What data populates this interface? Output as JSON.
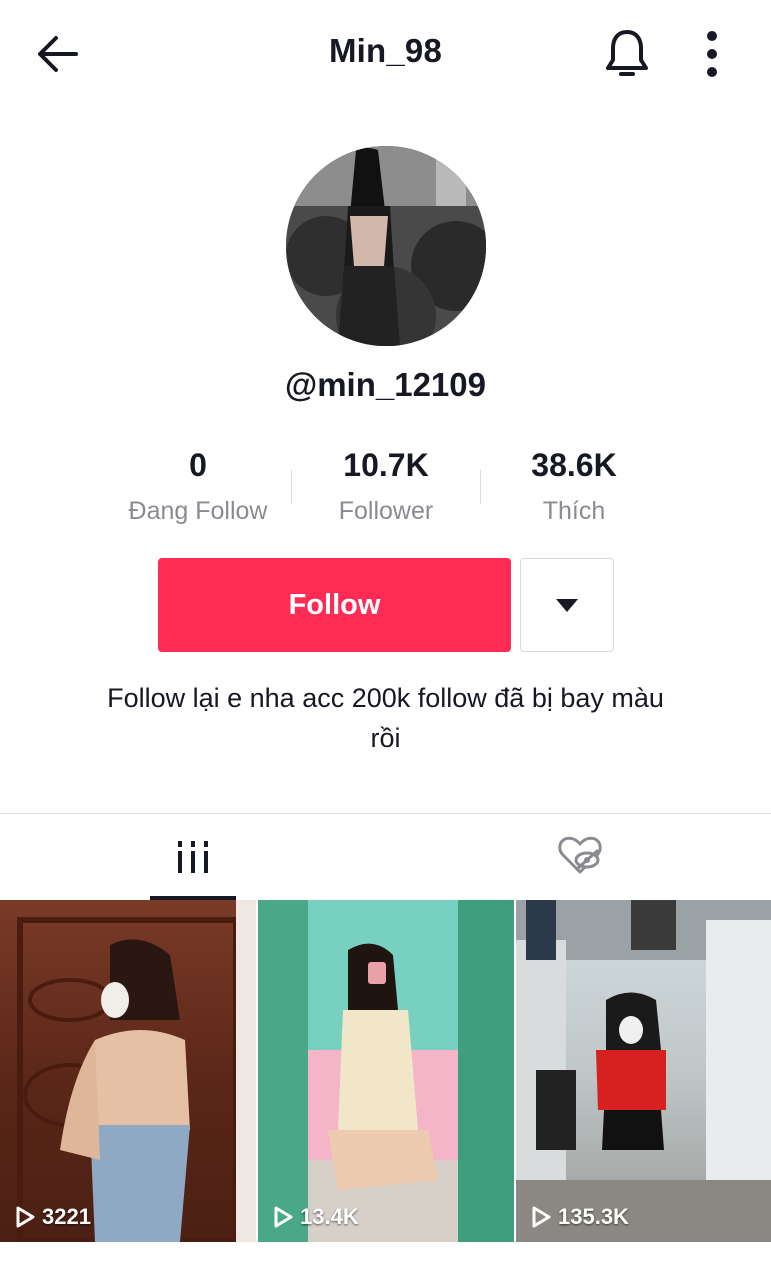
{
  "header": {
    "title": "Min_98"
  },
  "profile": {
    "handle": "@min_12109"
  },
  "stats": [
    {
      "value": "0",
      "label": "Đang Follow"
    },
    {
      "value": "10.7K",
      "label": "Follower"
    },
    {
      "value": "38.6K",
      "label": "Thích"
    }
  ],
  "actions": {
    "follow_label": "Follow"
  },
  "bio": "Follow lại e nha acc 200k follow đã bị bay màu rồi",
  "videos": [
    {
      "views": "3221"
    },
    {
      "views": "13.4K"
    },
    {
      "views": "135.3K"
    }
  ],
  "colors": {
    "accent": "#fe2c55",
    "text": "#161823",
    "muted": "#8a8b91"
  },
  "icons": [
    "back-arrow-icon",
    "bell-icon",
    "more-vertical-icon",
    "dropdown-triangle-icon",
    "videos-grid-icon",
    "liked-hidden-icon",
    "play-icon"
  ]
}
